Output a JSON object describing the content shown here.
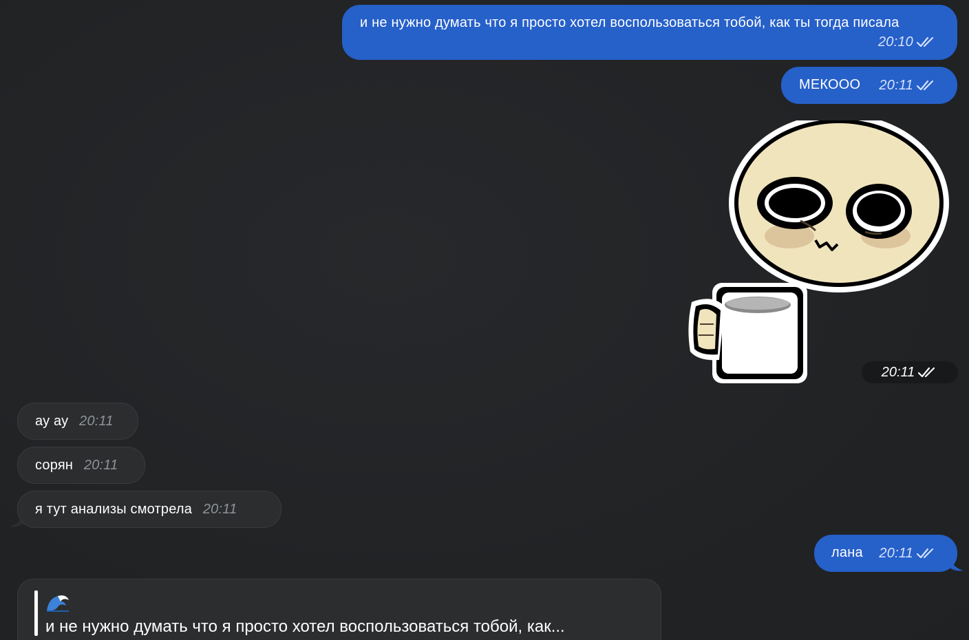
{
  "messages": {
    "m1": {
      "text": "и не нужно думать что я просто  хотел воспользоваться тобой, как ты тогда писала",
      "time": "20:10"
    },
    "m2": {
      "text": "МЕКООО",
      "time": "20:11"
    },
    "sticker": {
      "time": "20:11"
    },
    "m3": {
      "text": "ау ау",
      "time": "20:11"
    },
    "m4": {
      "text": "сорян",
      "time": "20:11"
    },
    "m5": {
      "text": "я тут анализы смотрела",
      "time": "20:11"
    },
    "m6": {
      "text": "лана",
      "time": "20:11"
    }
  },
  "reply": {
    "quoted_text": "и не нужно думать что я просто  хотел воспользоваться тобой, как..."
  },
  "icons": {
    "read_status": "double-check-icon",
    "reply_emoji": "wave-emoji-icon",
    "sticker": "cup-holding-face-sticker"
  },
  "colors": {
    "outgoing_bubble": "#2660c9",
    "incoming_bubble": "#2c2d2f",
    "background": "#212325"
  }
}
